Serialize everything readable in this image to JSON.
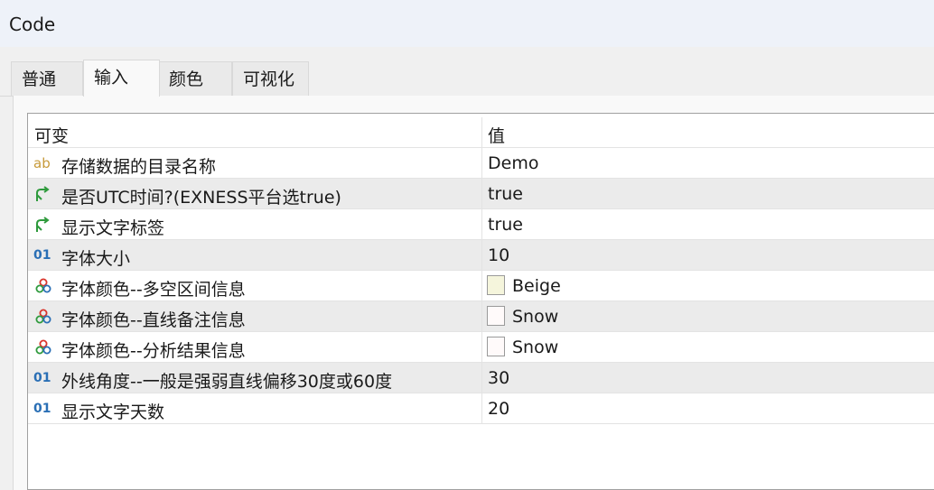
{
  "window": {
    "title": "Code"
  },
  "tabs": [
    {
      "label": "普通"
    },
    {
      "label": "输入",
      "active": true
    },
    {
      "label": "颜色"
    },
    {
      "label": "可视化"
    }
  ],
  "table": {
    "headers": {
      "name": "可变",
      "value": "值"
    },
    "rows": [
      {
        "icon": "string-type-icon",
        "icon_text": "ab",
        "name": "存储数据的目录名称",
        "value": "Demo"
      },
      {
        "icon": "bool-type-icon",
        "name": "是否UTC时间?(EXNESS平台选true)",
        "value": "true"
      },
      {
        "icon": "bool-type-icon",
        "name": "显示文字标签",
        "value": "true"
      },
      {
        "icon": "int-type-icon",
        "icon_text": "01",
        "name": "字体大小",
        "value": "10"
      },
      {
        "icon": "color-type-icon",
        "name": "字体颜色--多空区间信息",
        "value": "Beige",
        "swatch": "#f5f5dc"
      },
      {
        "icon": "color-type-icon",
        "name": "字体颜色--直线备注信息",
        "value": "Snow",
        "swatch": "#fffafa"
      },
      {
        "icon": "color-type-icon",
        "name": "字体颜色--分析结果信息",
        "value": "Snow",
        "swatch": "#fffafa"
      },
      {
        "icon": "int-type-icon",
        "icon_text": "01",
        "name": "外线角度--一般是强弱直线偏移30度或60度",
        "value": "30"
      },
      {
        "icon": "int-type-icon",
        "icon_text": "01",
        "name": "显示文字天数",
        "value": "20"
      }
    ]
  },
  "colors": {
    "bool_icon": "#2e9a3c",
    "string_icon": "#c79a3a",
    "int_icon": "#2a6fb5"
  }
}
